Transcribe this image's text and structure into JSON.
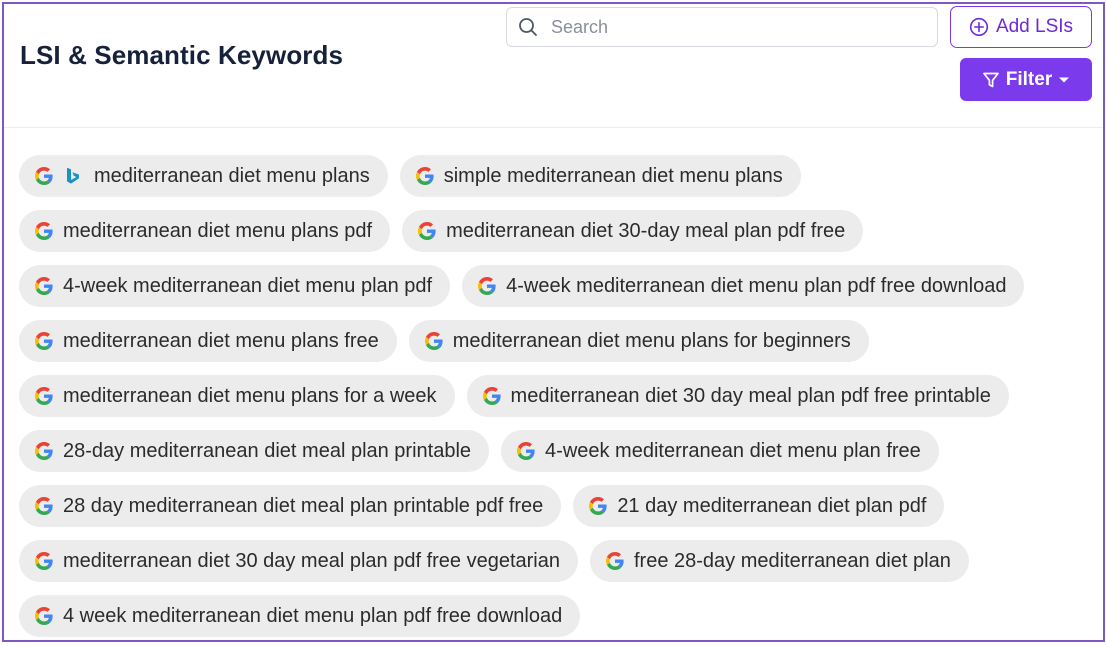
{
  "header": {
    "title": "LSI & Semantic Keywords",
    "search": {
      "placeholder": "Search",
      "value": ""
    },
    "add_button_label": "Add LSIs",
    "filter_button_label": "Filter"
  },
  "colors": {
    "accent": "#7c3aed",
    "frame_border": "#7e57c2",
    "chip_background": "#ececec"
  },
  "keywords": [
    {
      "text": "mediterranean diet menu plans",
      "sources": [
        "google-icon",
        "bing-icon"
      ]
    },
    {
      "text": "simple mediterranean diet menu plans",
      "sources": [
        "google-icon"
      ]
    },
    {
      "text": "mediterranean diet menu plans pdf",
      "sources": [
        "google-icon"
      ]
    },
    {
      "text": "mediterranean diet 30-day meal plan pdf free",
      "sources": [
        "google-icon"
      ]
    },
    {
      "text": "4-week mediterranean diet menu plan pdf",
      "sources": [
        "google-icon"
      ]
    },
    {
      "text": "4-week mediterranean diet menu plan pdf free download",
      "sources": [
        "google-icon"
      ]
    },
    {
      "text": "mediterranean diet menu plans free",
      "sources": [
        "google-icon"
      ]
    },
    {
      "text": "mediterranean diet menu plans for beginners",
      "sources": [
        "google-icon"
      ]
    },
    {
      "text": "mediterranean diet menu plans for a week",
      "sources": [
        "google-icon"
      ]
    },
    {
      "text": "mediterranean diet 30 day meal plan pdf free printable",
      "sources": [
        "google-icon"
      ]
    },
    {
      "text": "28-day mediterranean diet meal plan printable",
      "sources": [
        "google-icon"
      ]
    },
    {
      "text": "4-week mediterranean diet menu plan free",
      "sources": [
        "google-icon"
      ]
    },
    {
      "text": "28 day mediterranean diet meal plan printable pdf free",
      "sources": [
        "google-icon"
      ]
    },
    {
      "text": "21 day mediterranean diet plan pdf",
      "sources": [
        "google-icon"
      ]
    },
    {
      "text": "mediterranean diet 30 day meal plan pdf free vegetarian",
      "sources": [
        "google-icon"
      ]
    },
    {
      "text": "free 28-day mediterranean diet plan",
      "sources": [
        "google-icon"
      ]
    },
    {
      "text": "4 week mediterranean diet menu plan pdf free download",
      "sources": [
        "google-icon"
      ]
    }
  ]
}
